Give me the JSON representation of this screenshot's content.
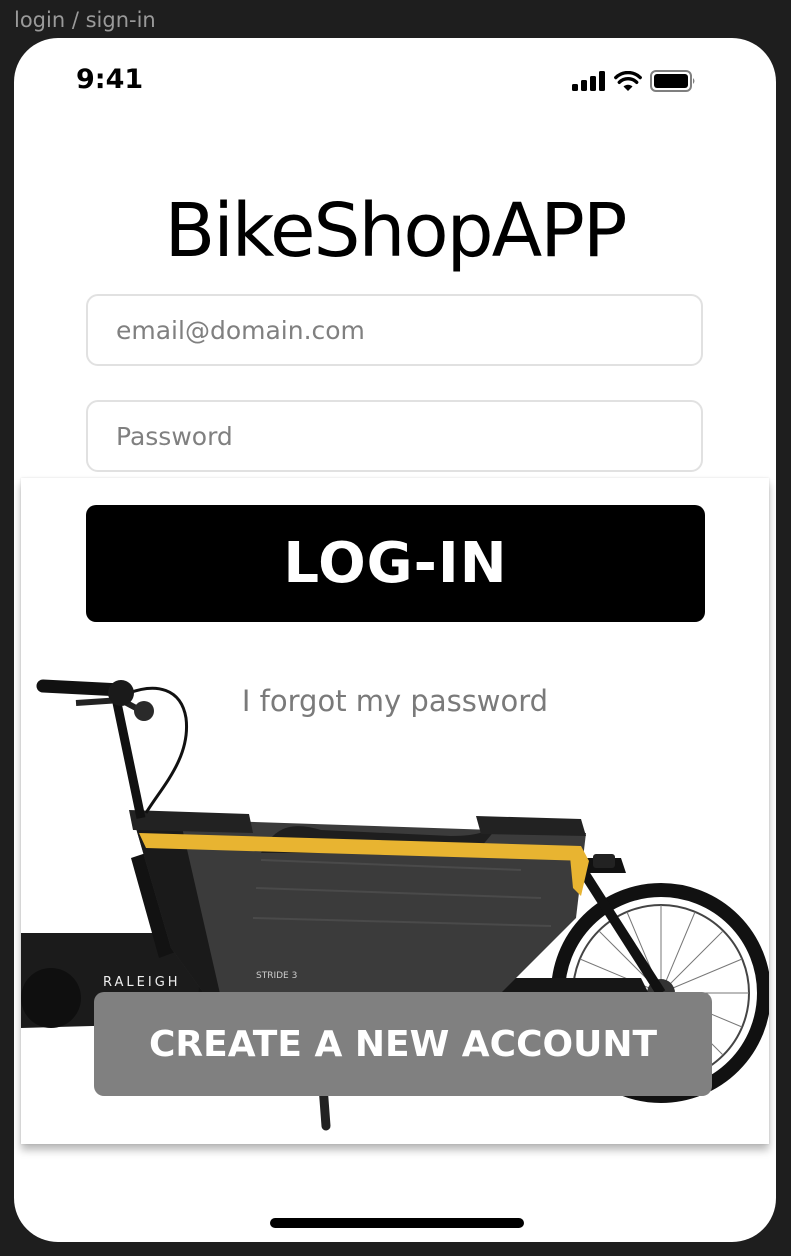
{
  "frame": {
    "label": "login / sign-in"
  },
  "status_bar": {
    "time": "9:41",
    "icons": [
      "signal-icon",
      "wifi-icon",
      "battery-icon"
    ]
  },
  "app": {
    "title": "BikeShopAPP"
  },
  "login_form": {
    "email": {
      "placeholder": "email@domain.com",
      "value": ""
    },
    "password": {
      "placeholder": "Password",
      "value": ""
    },
    "login_label": "LOG-IN",
    "forgot_label": "I forgot my password"
  },
  "hero": {
    "image_name": "cargo-bike-image",
    "brand_text": "RALEIGH",
    "model_text": "STRIDE 3"
  },
  "create_account_label": "CREATE A NEW ACCOUNT",
  "colors": {
    "primary_button": "#000000",
    "secondary_button": "#808080",
    "bike_accent": "#e8b431"
  }
}
